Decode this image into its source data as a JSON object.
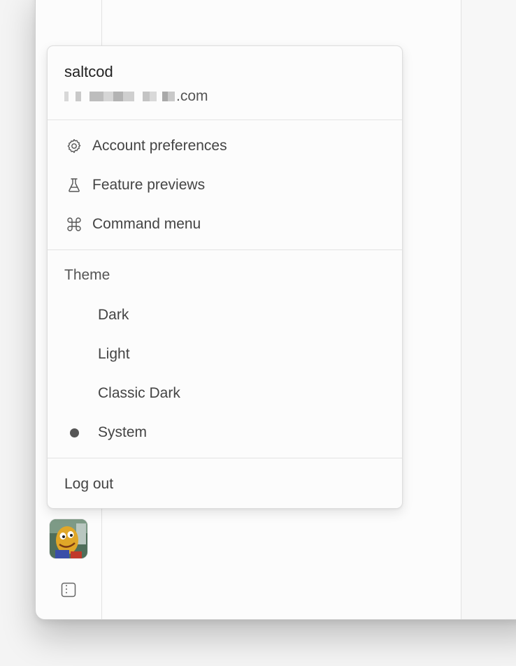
{
  "user": {
    "name": "saltcod",
    "email_suffix": ".com"
  },
  "menu": {
    "items": [
      {
        "label": "Account preferences",
        "icon": "gear-icon"
      },
      {
        "label": "Feature previews",
        "icon": "flask-icon"
      },
      {
        "label": "Command menu",
        "icon": "command-icon"
      }
    ],
    "theme": {
      "heading": "Theme",
      "options": [
        {
          "label": "Dark",
          "selected": false
        },
        {
          "label": "Light",
          "selected": false
        },
        {
          "label": "Classic Dark",
          "selected": false
        },
        {
          "label": "System",
          "selected": true
        }
      ]
    },
    "logout_label": "Log out"
  },
  "colors": {
    "text": "#444444",
    "selected_dot": "#555555",
    "divider": "#e3e3e3"
  }
}
